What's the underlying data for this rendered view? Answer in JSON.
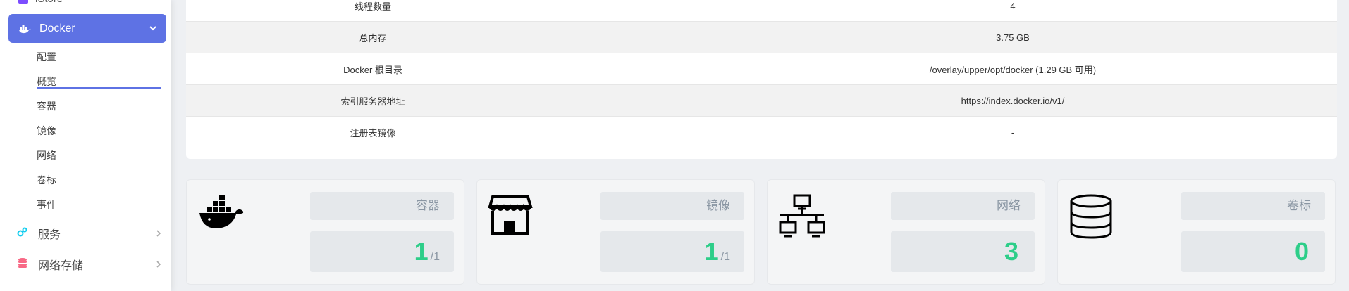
{
  "sidebar": {
    "top_partial": "iStore",
    "docker": {
      "label": "Docker"
    },
    "docker_sub": [
      "配置",
      "概览",
      "容器",
      "镜像",
      "网络",
      "卷标",
      "事件"
    ],
    "services": {
      "label": "服务"
    },
    "net_storage": {
      "label": "网络存储"
    }
  },
  "info": {
    "rows": [
      {
        "key": "线程数量",
        "value": "4"
      },
      {
        "key": "总内存",
        "value": "3.75 GB"
      },
      {
        "key": "Docker 根目录",
        "value": "/overlay/upper/opt/docker (1.29 GB 可用)"
      },
      {
        "key": "索引服务器地址",
        "value": "https://index.docker.io/v1/"
      },
      {
        "key": "注册表镜像",
        "value": "-"
      }
    ]
  },
  "cards": [
    {
      "label": "容器",
      "value": "1",
      "total": "/1",
      "icon": "docker-whale-icon"
    },
    {
      "label": "镜像",
      "value": "1",
      "total": "/1",
      "icon": "store-icon"
    },
    {
      "label": "网络",
      "value": "3",
      "total": "",
      "icon": "network-icon"
    },
    {
      "label": "卷标",
      "value": "0",
      "total": "",
      "icon": "database-icon"
    }
  ],
  "colors": {
    "accent": "#5e72e4",
    "success": "#2dce89"
  }
}
